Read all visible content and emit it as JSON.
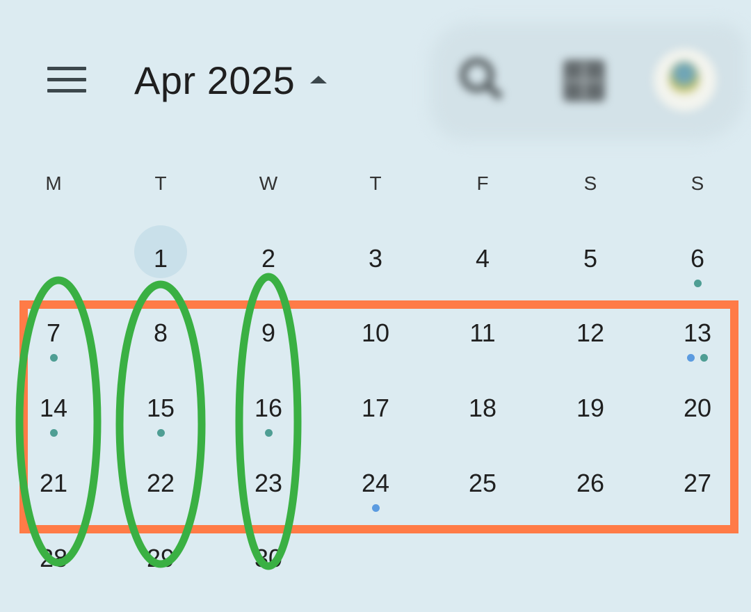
{
  "header": {
    "month_label": "Apr 2025",
    "icons": {
      "menu": "hamburger-menu-icon",
      "caret": "caret-up-icon",
      "search": "search-icon",
      "grid": "grid-icon",
      "avatar": "avatar"
    }
  },
  "weekdays": [
    "M",
    "T",
    "W",
    "T",
    "F",
    "S",
    "S"
  ],
  "weeks": [
    [
      null,
      "1",
      "2",
      "3",
      "4",
      "5",
      "6"
    ],
    [
      "7",
      "8",
      "9",
      "10",
      "11",
      "12",
      "13"
    ],
    [
      "14",
      "15",
      "16",
      "17",
      "18",
      "19",
      "20"
    ],
    [
      "21",
      "22",
      "23",
      "24",
      "25",
      "26",
      "27"
    ],
    [
      "28",
      "29",
      "30",
      null,
      null,
      null,
      null
    ]
  ],
  "today": "1",
  "event_dots": {
    "6": [
      "teal"
    ],
    "7": [
      "teal"
    ],
    "13": [
      "blue",
      "teal"
    ],
    "14": [
      "teal"
    ],
    "15": [
      "teal"
    ],
    "16": [
      "teal"
    ],
    "24": [
      "blue"
    ]
  },
  "colors": {
    "background": "#dcebf1",
    "text": "#1f1f1f",
    "today_highlight": "#c9e0ea",
    "dot_teal": "#4f9e94",
    "dot_blue": "#5b9be0",
    "annotation_orange": "#ff7b47",
    "annotation_green": "#3ab043"
  },
  "annotations": {
    "highlight_rectangle": "orange rectangle spanning weeks starting 7, 14 and 21",
    "highlight_ellipses": [
      "Monday column",
      "Tuesday column",
      "Wednesday column"
    ]
  }
}
